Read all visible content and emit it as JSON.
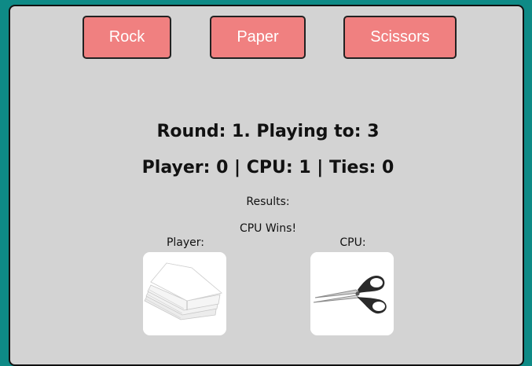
{
  "buttons": {
    "rock": "Rock",
    "paper": "Paper",
    "scissors": "Scissors"
  },
  "status": {
    "round_line": "Round: 1. Playing to: 3",
    "score_line": "Player: 0 | CPU: 1 | Ties: 0"
  },
  "results": {
    "label": "Results:",
    "outcome": "CPU Wins!",
    "player_label": "Player:",
    "cpu_label": "CPU:",
    "player_choice_icon": "paper-stack-icon",
    "cpu_choice_icon": "scissors-icon"
  },
  "colors": {
    "page_background": "#0e8a86",
    "panel_background": "#d3d3d3",
    "button_background": "#f08080",
    "button_text": "#ffffff"
  }
}
